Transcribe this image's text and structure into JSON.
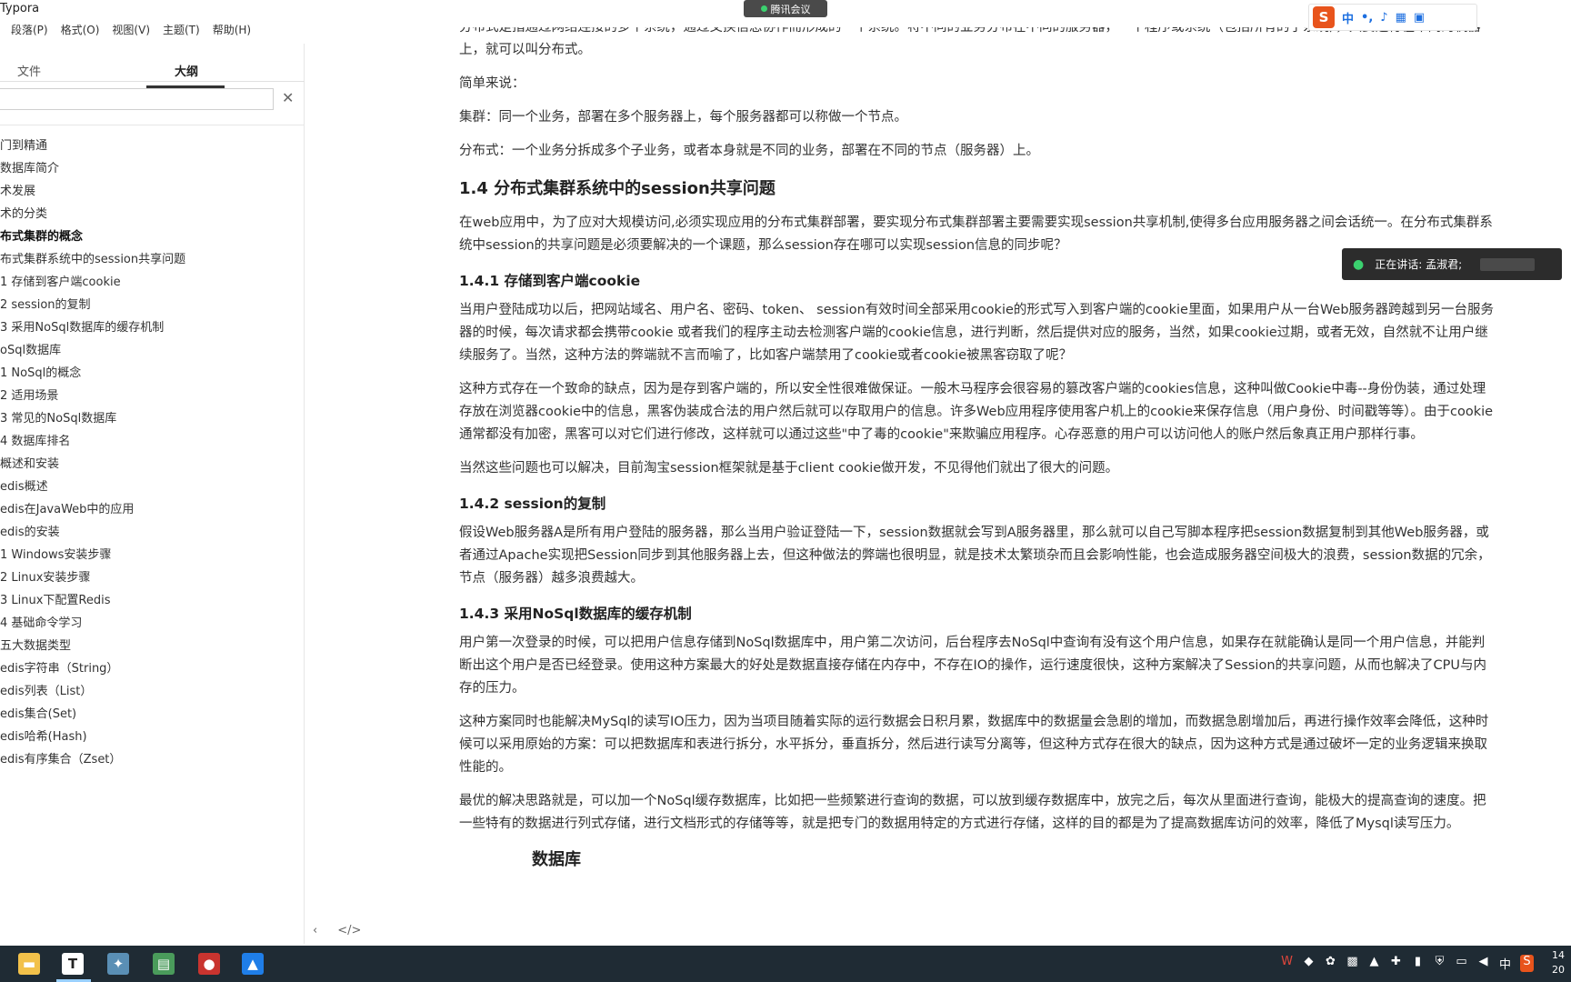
{
  "app": {
    "title": "Typora"
  },
  "menu": [
    "段落(P)",
    "格式(O)",
    "视图(V)",
    "主题(T)",
    "帮助(H)"
  ],
  "sidebar": {
    "tabs": {
      "files": "文件",
      "outline": "大纲"
    },
    "search": {
      "value": "",
      "close_label": "✕"
    },
    "outline_items": [
      "门到精通",
      "数据库简介",
      "术发展",
      "术的分类",
      "布式集群的概念",
      "布式集群系统中的session共享问题",
      "1 存储到客户端cookie",
      "2 session的复制",
      "3 采用NoSql数据库的缓存机制",
      "oSql数据库",
      "1 NoSql的概念",
      "2 适用场景",
      "3 常见的NoSql数据库",
      "4 数据库排名",
      "概述和安装",
      "edis概述",
      "edis在JavaWeb中的应用",
      "edis的安装",
      "1 Windows安装步骤",
      "2 Linux安装步骤",
      "3 Linux下配置Redis",
      "4 基础命令学习",
      "五大数据类型",
      "edis字符串（String）",
      "edis列表（List）",
      "edis集合(Set)",
      "edis哈希(Hash)",
      "edis有序集合（Zset）"
    ],
    "active_index": 4,
    "footer": {
      "back": "‹",
      "source": "</>"
    }
  },
  "editor": {
    "p0": "分布式是指通过网络连接的多个系统，通过交换信息协作而形成的一个系统。将不同的业务分布在不同的服务器，一个程序或系统（包括所有的子系统），只要运行在不同的机器上，就可以叫分布式。",
    "p1": "简单来说：",
    "p2": "集群：同一个业务，部署在多个服务器上，每个服务器都可以称做一个节点。",
    "p3": "分布式：一个业务分拆成多个子业务，或者本身就是不同的业务，部署在不同的节点（服务器）上。",
    "h14": "1.4 分布式集群系统中的session共享问题",
    "p4": "在web应用中，为了应对大规模访问,必须实现应用的分布式集群部署，要实现分布式集群部署主要需要实现session共享机制,使得多台应用服务器之间会话统一。在分布式集群系统中session的共享问题是必须要解决的一个课题，那么session存在哪可以实现session信息的同步呢？",
    "h141": "1.4.1 存储到客户端cookie",
    "p5": "当用户登陆成功以后，把网站域名、用户名、密码、token、 session有效时间全部采用cookie的形式写入到客户端的cookie里面，如果用户从一台Web服务器跨越到另一台服务器的时候，每次请求都会携带cookie 或者我们的程序主动去检测客户端的cookie信息，进行判断，然后提供对应的服务，当然，如果cookie过期，或者无效，自然就不让用户继续服务了。当然，这种方法的弊端就不言而喻了，比如客户端禁用了cookie或者cookie被黑客窃取了呢？",
    "p6": "这种方式存在一个致命的缺点，因为是存到客户端的，所以安全性很难做保证。一般木马程序会很容易的篡改客户端的cookies信息，这种叫做Cookie中毒--身份伪装，通过处理存放在浏览器cookie中的信息，黑客伪装成合法的用户然后就可以存取用户的信息。许多Web应用程序使用客户机上的cookie来保存信息（用户身份、时间戳等等）。由于cookie通常都没有加密，黑客可以对它们进行修改，这样就可以通过这些\"中了毒的cookie\"来欺骗应用程序。心存恶意的用户可以访问他人的账户然后象真正用户那样行事。",
    "p7": "当然这些问题也可以解决，目前淘宝session框架就是基于client cookie做开发，不见得他们就出了很大的问题。",
    "h142": "1.4.2 session的复制",
    "p8": "假设Web服务器A是所有用户登陆的服务器，那么当用户验证登陆一下，session数据就会写到A服务器里，那么就可以自己写脚本程序把session数据复制到其他Web服务器，或者通过Apache实现把Session同步到其他服务器上去，但这种做法的弊端也很明显，就是技术太繁琐杂而且会影响性能，也会造成服务器空间极大的浪费，session数据的冗余，节点（服务器）越多浪费越大。",
    "h143": "1.4.3 采用NoSql数据库的缓存机制",
    "p9": "用户第一次登录的时候，可以把用户信息存储到NoSql数据库中，用户第二次访问，后台程序去NoSql中查询有没有这个用户信息，如果存在就能确认是同一个用户信息，并能判断出这个用户是否已经登录。使用这种方案最大的好处是数据直接存储在内存中，不存在IO的操作，运行速度很快，这种方案解决了Session的共享问题，从而也解决了CPU与内存的压力。",
    "p10": "这种方案同时也能解决MySql的读写IO压力，因为当项目随着实际的运行数据会日积月累，数据库中的数据量会急剧的增加，而数据急剧增加后，再进行操作效率会降低，这种时候可以采用原始的方案：可以把数据库和表进行拆分，水平拆分，垂直拆分，然后进行读写分离等，但这种方式存在很大的缺点，因为这种方式是通过破坏一定的业务逻辑来换取性能的。",
    "p11": "最优的解决思路就是，可以加一个NoSql缓存数据库，比如把一些频繁进行查询的数据，可以放到缓存数据库中，放完之后，每次从里面进行查询，能极大的提高查询的速度。把一些特有的数据进行列式存储，进行文档形式的存储等等，就是把专门的数据用特定的方式进行存储，这样的目的都是为了提高数据库访问的效率，降低了Mysql读写压力。",
    "next_heading": "数据库"
  },
  "overlays": {
    "meeting_label": "腾讯会议",
    "speaking_label": "正在讲话: 孟淑君;",
    "ime": {
      "logo": "S",
      "mode": "中"
    }
  },
  "taskbar": {
    "clock": {
      "time": "14",
      "date": "20"
    },
    "tray_input": "中"
  }
}
